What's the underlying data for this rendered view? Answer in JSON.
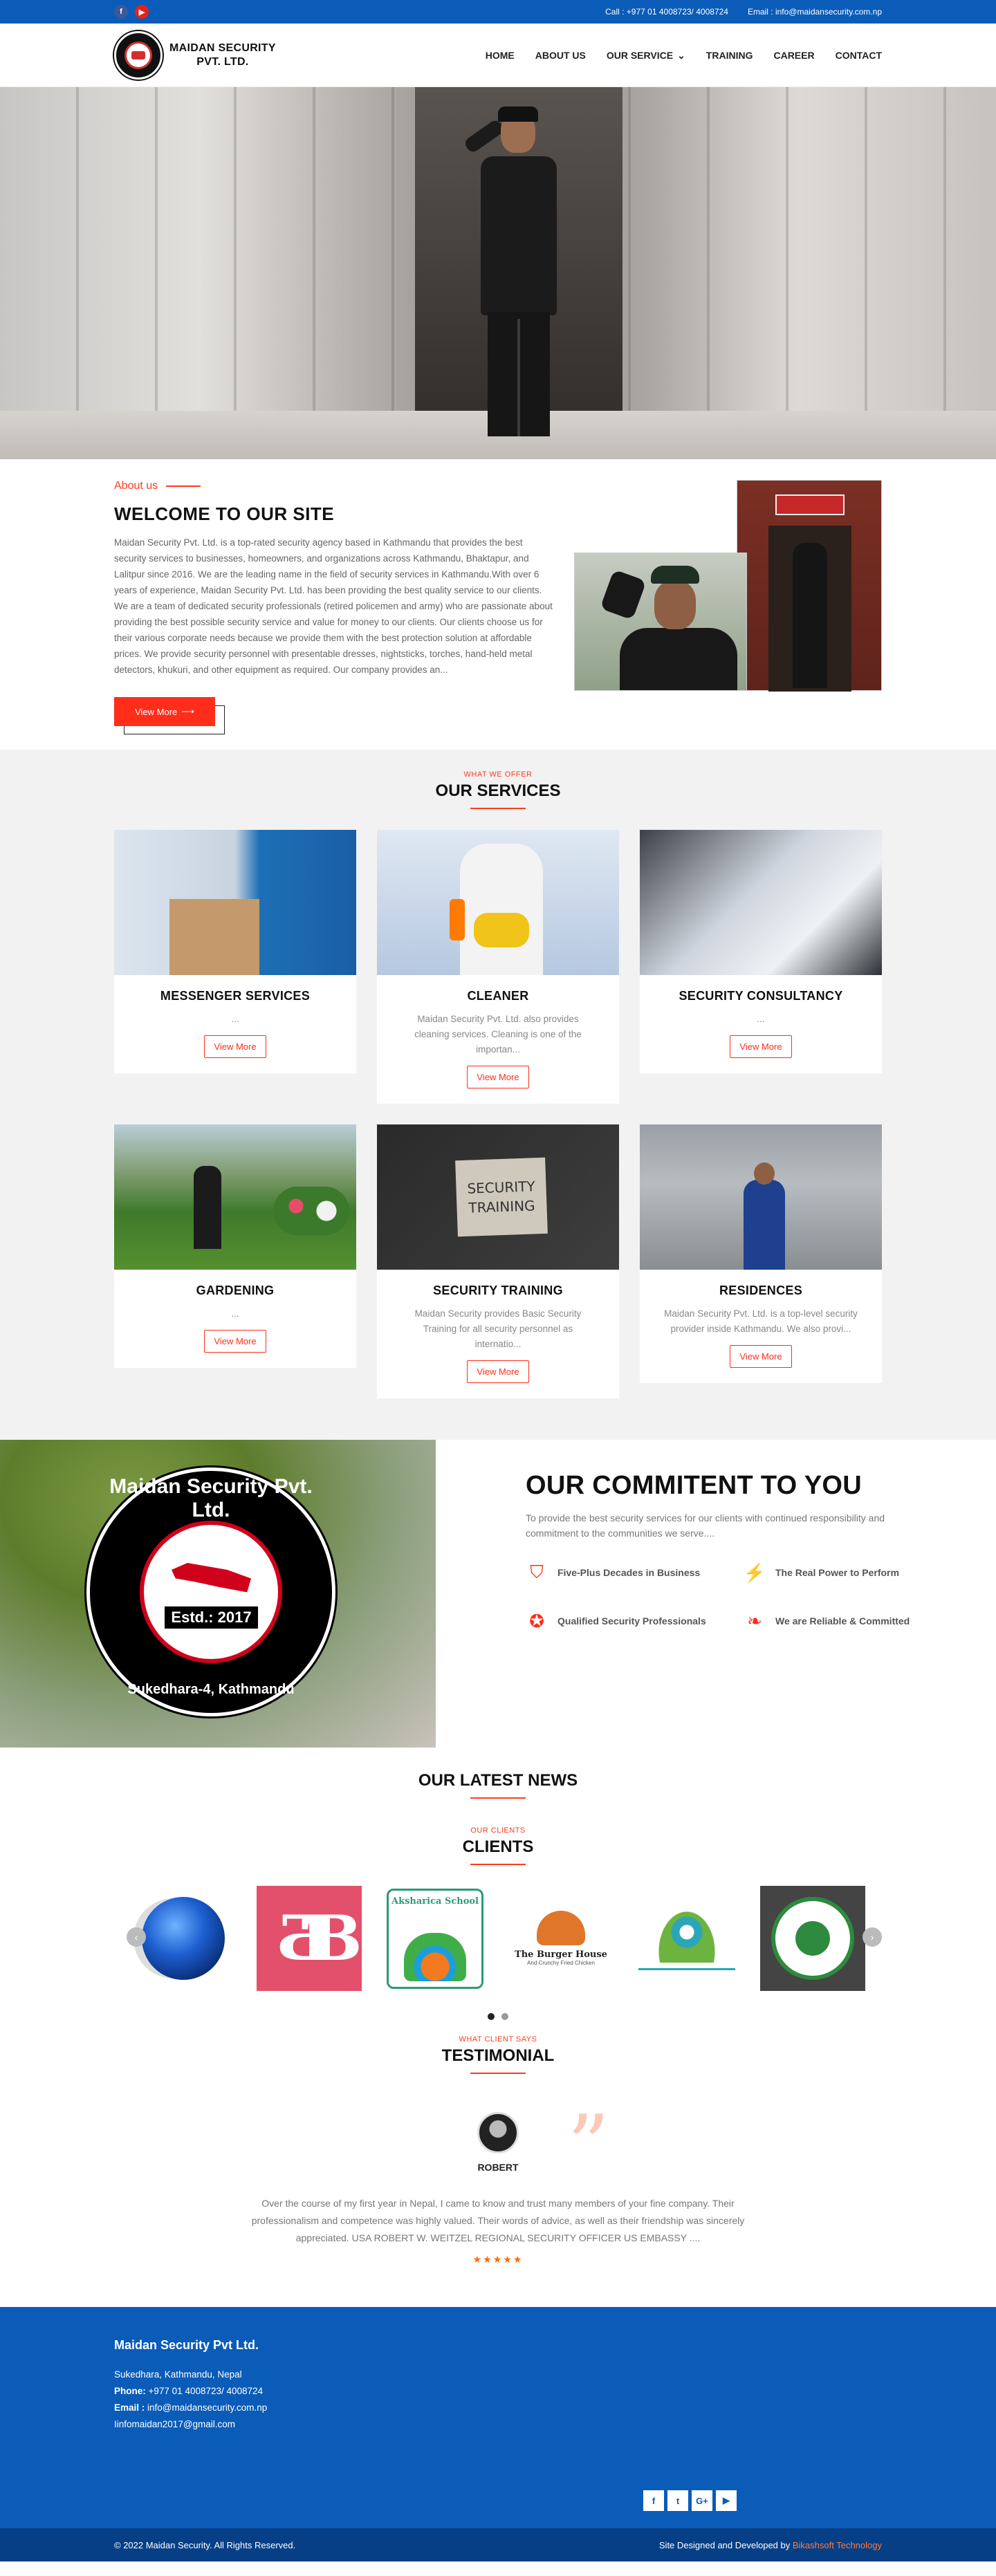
{
  "topbar": {
    "social": [
      {
        "icon": "facebook-icon",
        "glyph": "f"
      },
      {
        "icon": "youtube-icon",
        "glyph": "▶"
      }
    ],
    "call": "Call : +977 01 4008723/ 4008724",
    "email": "Email : info@maidansecurity.com.np"
  },
  "header": {
    "logo_line1": "MAIDAN SECURITY",
    "logo_line2": "PVT. LTD.",
    "nav": [
      "HOME",
      "ABOUT US",
      "OUR SERVICE",
      "TRAINING",
      "CAREER",
      "CONTACT"
    ]
  },
  "about": {
    "eyebrow": "About us",
    "title": "WELCOME TO OUR SITE",
    "text": "Maidan Security Pvt. Ltd. is a top-rated security agency based in Kathmandu that provides the best security services to businesses, homeowners, and organizations across Kathmandu, Bhaktapur, and Lalitpur since 2016. We are the leading name in the field of security services in Kathmandu.With over 6 years of experience, Maidan Security Pvt. Ltd. has been providing the best quality service to our clients. We are a team of dedicated security professionals (retired policemen and army) who are passionate about providing the best possible security service and value for money to our clients. Our clients choose us for their various corporate needs because we provide them with the best protection solution at affordable prices. We provide security personnel with presentable dresses, nightsticks, torches, hand-held metal detectors, khukuri, and other equipment as required. Our company provides an...",
    "button": "View More"
  },
  "services": {
    "eyebrow": "WHAT WE OFFER",
    "title": "OUR SERVICES",
    "items": [
      {
        "title": "MESSENGER SERVICES",
        "text": "...",
        "button": "View More"
      },
      {
        "title": "CLEANER",
        "text": "Maidan Security Pvt. Ltd. also provides cleaning services. Cleaning is one of the importan...",
        "button": "View More"
      },
      {
        "title": "SECURITY CONSULTANCY",
        "text": "...",
        "button": "View More"
      },
      {
        "title": "GARDENING",
        "text": "...",
        "button": "View More"
      },
      {
        "title": "SECURITY TRAINING",
        "text": "Maidan  Security provides Basic Security Training for all security personnel as internatio...",
        "button": "View More"
      },
      {
        "title": "RESIDENCES",
        "text": "Maidan Security Pvt. Ltd. is a top-level security provider inside Kathmandu. We also provi...",
        "button": "View More"
      }
    ],
    "training_sign_line1": "SECURITY",
    "training_sign_line2": "TRAINING"
  },
  "commitment": {
    "badge_top": "Maidan Security Pvt. Ltd.",
    "badge_estd": "Estd.: 2017",
    "badge_bottom": "Sukedhara-4, Kathmandu",
    "title": "OUR COMMITENT TO YOU",
    "text": "To provide the best security services for our clients with continued responsibility and commitment  to the communities we serve....",
    "features": [
      {
        "label": "Five-Plus Decades in Business",
        "icon": "shield-icon",
        "glyph": "⛉"
      },
      {
        "label": "The Real Power to Perform",
        "icon": "lightning-icon",
        "glyph": "⚡"
      },
      {
        "label": "Qualified Security Professionals",
        "icon": "badge-icon",
        "glyph": "✪"
      },
      {
        "label": "We are Reliable & Committed",
        "icon": "handshake-icon",
        "glyph": "❧"
      }
    ]
  },
  "news": {
    "title": "OUR LATEST NEWS"
  },
  "clients": {
    "eyebrow": "OUR CLIENTS",
    "title": "CLIENTS",
    "logos": [
      {
        "name": "client-logo-globe"
      },
      {
        "name": "client-logo-db"
      },
      {
        "name": "client-logo-akshanika",
        "text": "Aksharica School"
      },
      {
        "name": "client-logo-burger-house",
        "text": "The Burger House",
        "sub": "And Crunchy Fried Chicken"
      },
      {
        "name": "client-logo-lotus"
      },
      {
        "name": "client-logo-cooperative"
      }
    ]
  },
  "testimonial": {
    "eyebrow": "WHAT CLIENT SAYS",
    "title": "TESTIMONIAL",
    "name": "ROBERT",
    "text": "Over the course of my first year in Nepal, I came to know and trust many members of your fine company. Their professionalism and competence was highly valued. Their words of advice, as well as their friendship was sincerely appreciated. USA ROBERT W. WEITZEL REGIONAL SECURITY OFFICER US EMBASSY ....",
    "stars": "★★★★★"
  },
  "footer": {
    "title": "Maidan Security Pvt Ltd.",
    "address": "Sukedhara, Kathmandu, Nepal",
    "phone_label": "Phone:",
    "phone": "+977 01 4008723/ 4008724",
    "email_label": "Email :",
    "email": "info@maidansecurity.com.np",
    "email2": "Iinfomaidan2017@gmail.com",
    "social": [
      {
        "icon": "facebook-icon",
        "glyph": "f"
      },
      {
        "icon": "twitter-icon",
        "glyph": "t"
      },
      {
        "icon": "google-plus-icon",
        "glyph": "G+"
      },
      {
        "icon": "youtube-icon",
        "glyph": "▶"
      }
    ]
  },
  "bottom": {
    "copyright": "© 2022 Maidan Security. All Rights Reserved.",
    "credit": "Site Designed and Developed by",
    "credit_brand": "Bikashsoft Technology"
  }
}
